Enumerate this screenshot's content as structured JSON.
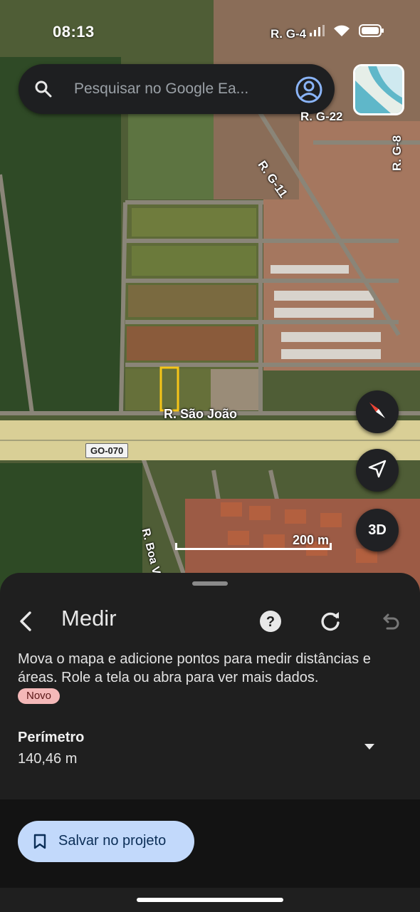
{
  "status_bar": {
    "time": "08:13"
  },
  "search": {
    "placeholder": "Pesquisar no Google Ea..."
  },
  "map": {
    "labels": {
      "street_g4": "R. G-4",
      "street_g22": "R. G-22",
      "street_g11": "R. G-11",
      "street_g8": "R. G-8",
      "street_sao_joao": "R. São João",
      "highway": "GO-070",
      "street_boa_vista": "R. Boa Vis"
    },
    "scale_label": "200 m",
    "button_3d": "3D"
  },
  "sheet": {
    "title": "Medir",
    "instructions": "Mova o mapa e adicione pontos para medir distâncias e áreas. Role a tela ou abra para ver mais dados.",
    "badge": "Novo",
    "perimeter_label": "Perímetro",
    "perimeter_value": "140,46 m",
    "save_button": "Salvar no projeto"
  },
  "colors": {
    "accent_button": "#c2d9fb",
    "badge_bg": "#f4b8b8",
    "measurement_outline": "#f5c518",
    "sheet_bg": "#1f1f1f"
  },
  "icons": [
    "search-icon",
    "account-circle-icon",
    "compass-icon",
    "navigation-arrow-icon",
    "back-chevron-icon",
    "help-icon",
    "refresh-icon",
    "undo-icon",
    "dropdown-arrow-icon",
    "bookmark-icon",
    "signal-icon",
    "wifi-icon",
    "battery-icon"
  ]
}
